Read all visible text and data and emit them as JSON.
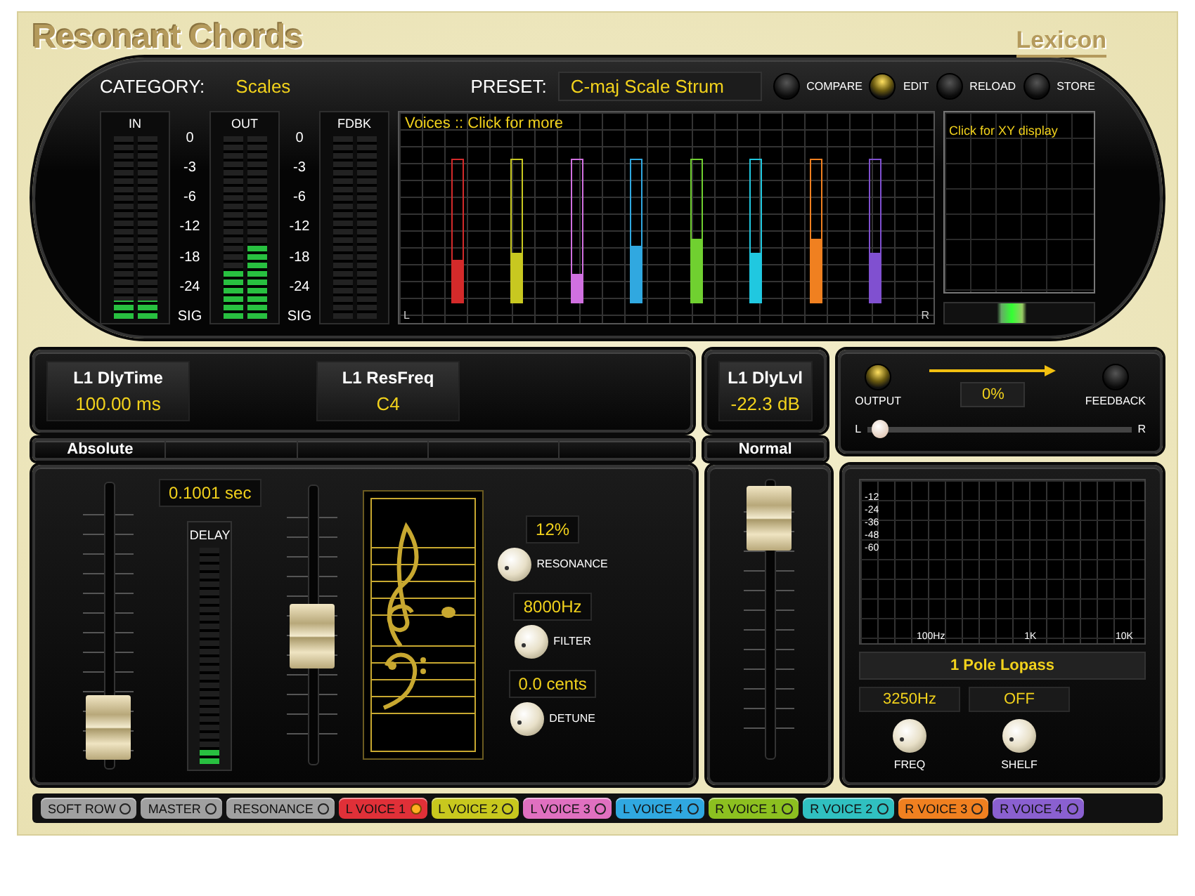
{
  "title": "Resonant Chords",
  "brand": "Lexicon",
  "header": {
    "category_label": "CATEGORY:",
    "category": "Scales",
    "preset_label": "PRESET:",
    "preset": "C-maj Scale Strum"
  },
  "buttons": [
    {
      "label": "COMPARE",
      "on": false
    },
    {
      "label": "EDIT",
      "on": true
    },
    {
      "label": "RELOAD",
      "on": false
    },
    {
      "label": "STORE",
      "on": false
    }
  ],
  "meters": [
    {
      "label": "IN",
      "channels": [
        {
          "level": 0.1
        },
        {
          "level": 0.1
        }
      ]
    },
    {
      "label": "OUT",
      "channels": [
        {
          "level": 0.27
        },
        {
          "level": 0.4
        }
      ]
    },
    {
      "label": "FDBK",
      "channels": [
        {
          "level": 0
        },
        {
          "level": 0
        }
      ]
    }
  ],
  "meter_scales": [
    [
      "0",
      "-3",
      "-6",
      "-12",
      "-18",
      "-24",
      "SIG"
    ],
    [
      "0",
      "-3",
      "-6",
      "-12",
      "-18",
      "-24",
      "SIG"
    ]
  ],
  "voices_display": {
    "label": "Voices :: Click for more",
    "left": "L",
    "right": "R",
    "voices": [
      {
        "color": "#d42a2a",
        "level": 0.3
      },
      {
        "color": "#c8c820",
        "level": 0.35
      },
      {
        "color": "#d070e0",
        "level": 0.2
      },
      {
        "color": "#30a8e0",
        "level": 0.4
      },
      {
        "color": "#70d030",
        "level": 0.45
      },
      {
        "color": "#20c8e0",
        "level": 0.35
      },
      {
        "color": "#f08020",
        "level": 0.45
      },
      {
        "color": "#8050d0",
        "level": 0.35
      }
    ]
  },
  "xy_display": {
    "label": "Click for XY display"
  },
  "soft_row": {
    "params": [
      {
        "name": "L1 DlyTime",
        "value": "100.00 ms"
      },
      {
        "name": "L1 ResFreq",
        "value": "C4"
      }
    ],
    "mode": "Absolute"
  },
  "level_param": {
    "name": "L1 DlyLvl",
    "value": "-22.3 dB",
    "mode": "Normal"
  },
  "routing": {
    "output": {
      "label": "OUTPUT",
      "on": true
    },
    "feedback": {
      "label": "FEEDBACK",
      "on": false
    },
    "readout": "0%",
    "left": "L",
    "right": "R",
    "pan": {
      "level": 0.02
    }
  },
  "editor": {
    "delay_fader": {
      "level": 0.04
    },
    "delay_readout": "0.1001 sec",
    "delay_label": "DELAY",
    "delay_meter": {
      "level": 0.08
    },
    "fader_2": {
      "level": 0.45
    },
    "knobs": [
      {
        "readout": "12%",
        "label": "RESONANCE"
      },
      {
        "readout": "8000Hz",
        "label": "FILTER"
      },
      {
        "readout": "0.0 cents",
        "label": "DETUNE"
      }
    ]
  },
  "level_fader": {
    "level": 0.97
  },
  "filter": {
    "y_labels": [
      "-12",
      "-24",
      "-36",
      "-48",
      "-60"
    ],
    "x_labels": [
      "100Hz",
      "1K",
      "10K"
    ],
    "type": "1 Pole Lopass",
    "knobs": [
      {
        "readout": "3250Hz",
        "label": "FREQ"
      },
      {
        "readout": "OFF",
        "label": "SHELF"
      }
    ]
  },
  "tabs": [
    {
      "label": "SOFT ROW",
      "color": "#a0a0a0",
      "selected": false
    },
    {
      "label": "MASTER",
      "color": "#a0a0a0",
      "selected": false
    },
    {
      "label": "RESONANCE",
      "color": "#a0a0a0",
      "selected": false
    },
    {
      "label": "L VOICE 1",
      "color": "#e03038",
      "selected": true
    },
    {
      "label": "L VOICE 2",
      "color": "#c8c81e",
      "selected": false
    },
    {
      "label": "L VOICE 3",
      "color": "#e070c0",
      "selected": false
    },
    {
      "label": "L VOICE 4",
      "color": "#30a8e0",
      "selected": false
    },
    {
      "label": "R VOICE 1",
      "color": "#8cc020",
      "selected": false
    },
    {
      "label": "R VOICE 2",
      "color": "#30c0c0",
      "selected": false
    },
    {
      "label": "R VOICE 3",
      "color": "#f08020",
      "selected": false
    },
    {
      "label": "R VOICE 4",
      "color": "#8a60d0",
      "selected": false
    }
  ]
}
